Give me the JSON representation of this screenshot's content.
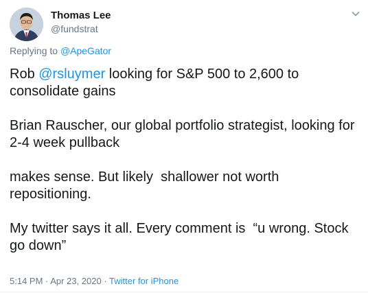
{
  "author": {
    "name": "Thomas Lee",
    "handle": "@fundstrat"
  },
  "reply": {
    "prefix": "Replying to ",
    "mention": "@ApeGator"
  },
  "tweet": {
    "p1_a": "Rob ",
    "p1_mention": "@rsluymer",
    "p1_b": " looking for S&P 500 to 2,600 to consolidate gains",
    "p2": "Brian Rauscher, our global portfolio strategist, looking for 2-4 week pullback",
    "p3": "makes sense. But likely  shallower not worth repositioning.",
    "p4": "My twitter says it all. Every comment is  “u wrong. Stock go down”"
  },
  "meta": {
    "time": "5:14 PM",
    "sep": " · ",
    "date": "Apr 23, 2020",
    "source": "Twitter for iPhone"
  },
  "colors": {
    "link": "#1b95e0",
    "muted": "#657786",
    "text": "#14171a"
  },
  "icons": {
    "menu": "chevron-down-icon"
  }
}
